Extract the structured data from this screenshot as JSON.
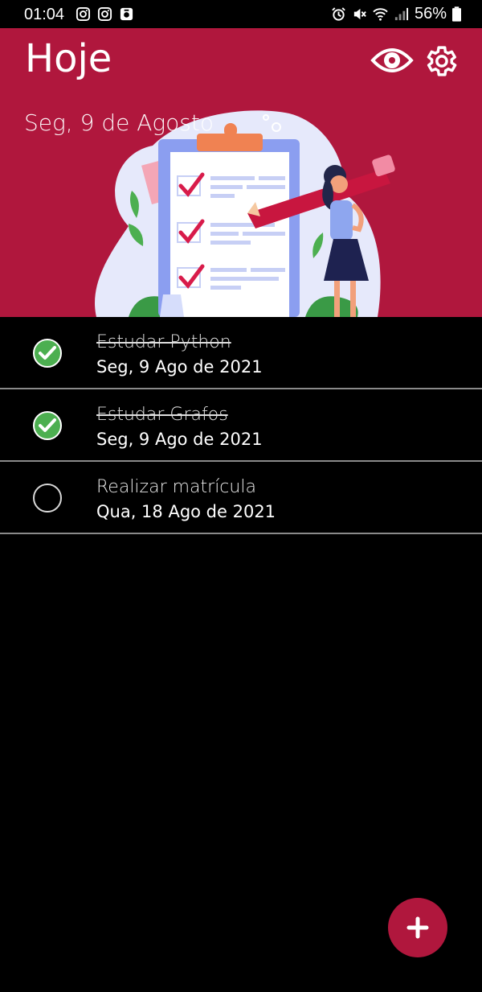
{
  "status_bar": {
    "time": "01:04",
    "battery": "56%",
    "icons": [
      "instagram-icon",
      "instagram-icon",
      "app-icon",
      "alarm-icon",
      "mute-icon",
      "wifi-icon",
      "signal-icon",
      "battery-icon"
    ]
  },
  "header": {
    "title": "Hoje",
    "date": "Seg, 9 de Agosto",
    "icons": [
      "eye-icon",
      "gear-icon"
    ],
    "background_color": "#b0173d"
  },
  "tasks": [
    {
      "name": "Estudar Python",
      "due": "Seg, 9 Ago de 2021",
      "done": true
    },
    {
      "name": "Estudar Grafos",
      "due": "Seg, 9 Ago de 2021",
      "done": true
    },
    {
      "name": "Realizar matrícula",
      "due": "Qua, 18 Ago de 2021",
      "done": false
    }
  ],
  "fab": {
    "icon": "plus-icon",
    "color": "#b0173d"
  },
  "colors": {
    "done_check": "#4caf50",
    "accent": "#b0173d"
  }
}
